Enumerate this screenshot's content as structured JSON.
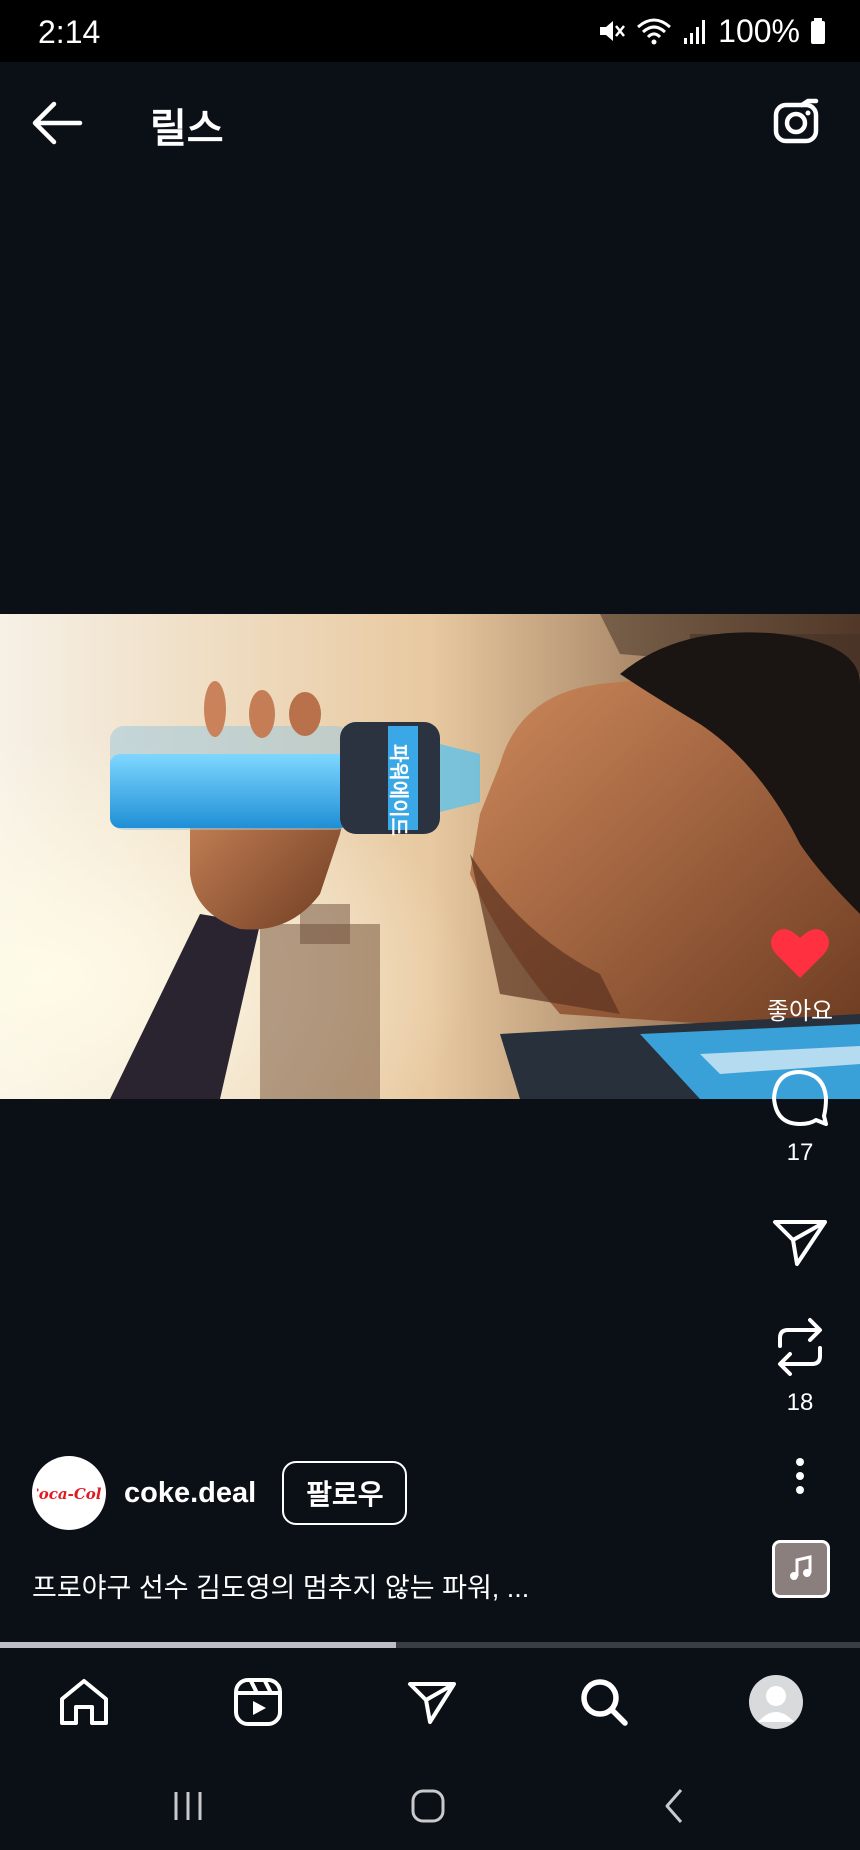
{
  "status_bar": {
    "time": "2:14",
    "battery": "100%"
  },
  "header": {
    "title": "릴스",
    "back_icon": "arrow-left-icon",
    "camera_icon": "camera-icon"
  },
  "actions": {
    "like": {
      "icon": "heart-icon",
      "label": "좋아요",
      "color": "#ff3040"
    },
    "comment": {
      "icon": "comment-icon",
      "count": "17"
    },
    "share": {
      "icon": "send-icon"
    },
    "remix": {
      "icon": "repost-icon",
      "count": "18"
    },
    "more": {
      "icon": "more-vertical-icon"
    }
  },
  "author": {
    "username": "coke.deal",
    "follow_label": "팔로우",
    "avatar_logo": "Coca-Cola"
  },
  "caption": "프로야구 선수 김도영의 멈추지 않는 파워, ...",
  "video": {
    "bottle_text": "파워에이드"
  },
  "playback": {
    "progress_percent": 46
  },
  "bottom_nav": [
    "home-icon",
    "reels-icon",
    "send-icon",
    "search-icon",
    "profile-avatar"
  ],
  "system_nav": [
    "recents-icon",
    "home-circle-icon",
    "back-chevron-icon"
  ]
}
